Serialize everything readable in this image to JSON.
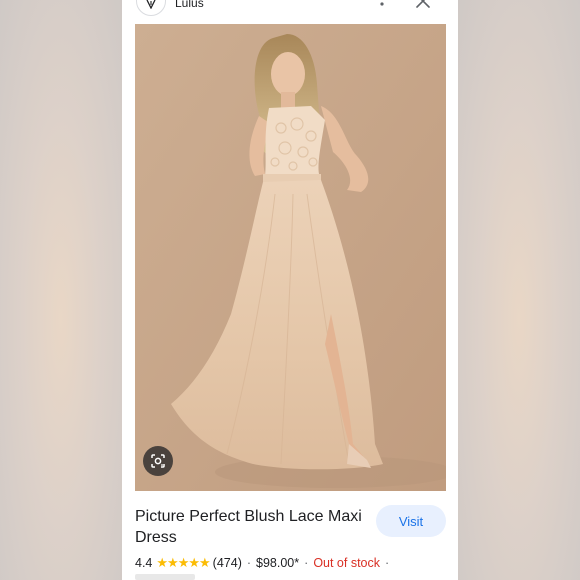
{
  "header": {
    "site_name": "Lulus",
    "logo_icon": "lulus-logo-icon",
    "more_icon": "more-vert-icon",
    "close_icon": "close-icon"
  },
  "image": {
    "alt": "Picture Perfect Blush Lace Maxi Dress",
    "lens_icon": "google-lens-icon"
  },
  "product": {
    "title": "Picture Perfect Blush Lace Maxi Dress",
    "visit_label": "Visit",
    "rating": "4.4",
    "stars": "★★★★★",
    "review_count": "(474)",
    "separator": "·",
    "price": "$98.00*",
    "stock_status": "Out of stock"
  },
  "colors": {
    "accent": "#1a73e8",
    "visit_bg": "#e8f0fe",
    "star": "#fbbc04",
    "out_of_stock": "#d93025"
  }
}
